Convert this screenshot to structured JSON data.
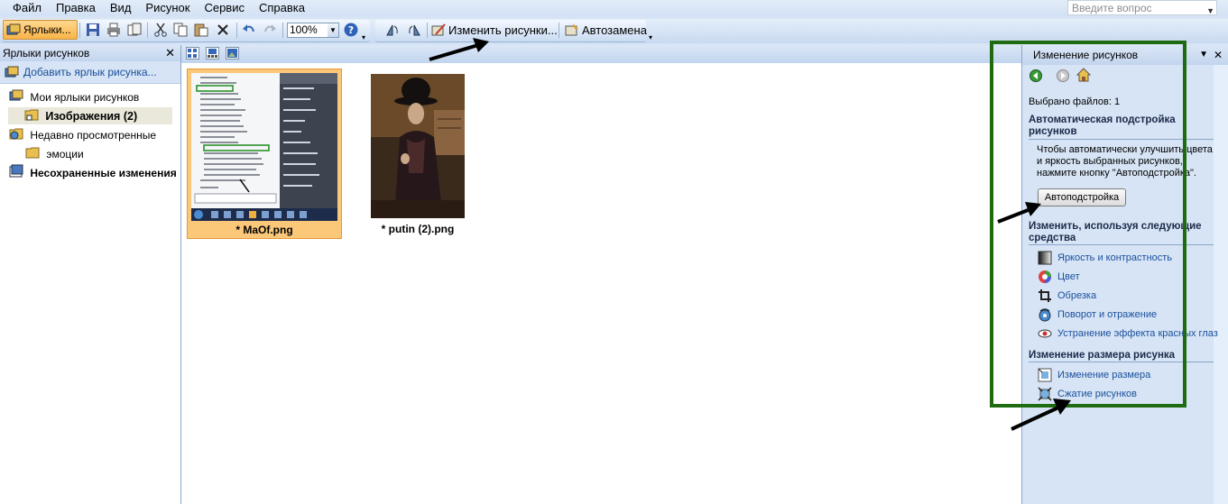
{
  "menu": {
    "items": [
      "Файл",
      "Правка",
      "Вид",
      "Рисунок",
      "Сервис",
      "Справка"
    ],
    "help_placeholder": "Введите вопрос"
  },
  "toolbar": {
    "shortcuts_label": "Ярлыки...",
    "zoom": "100%",
    "edit_pictures_label": "Изменить рисунки...",
    "autocorrect_label": "Автозамена"
  },
  "left_pane": {
    "title": "Ярлыки рисунков",
    "add_shortcut": "Добавить ярлык рисунка...",
    "tree": {
      "my_shortcuts": "Мои ярлыки рисунков",
      "images": "Изображения (2)",
      "recent": "Недавно просмотренные",
      "emoji": "эмоции",
      "unsaved": "Несохраненные изменения"
    }
  },
  "thumbnails": [
    {
      "label": "* MaOf.png",
      "selected": true
    },
    {
      "label": "* putin (2).png",
      "selected": false
    }
  ],
  "right_pane": {
    "title": "Изменение рисунков",
    "selected_files": "Выбрано файлов: 1",
    "auto_heading": "Автоматическая подстройка рисунков",
    "auto_text": "Чтобы автоматически улучшить цвета и яркость выбранных рисунков, нажмите кнопку \"Автоподстройка\".",
    "autofix_button": "Автоподстройка",
    "edit_heading": "Изменить, используя следующие средства",
    "tools": [
      {
        "label": "Яркость и контрастность",
        "icon": "brightness-icon"
      },
      {
        "label": "Цвет",
        "icon": "color-icon"
      },
      {
        "label": "Обрезка",
        "icon": "crop-icon"
      },
      {
        "label": "Поворот и отражение",
        "icon": "rotate-icon"
      },
      {
        "label": "Устранение эффекта красных глаз",
        "icon": "red-eye-icon"
      }
    ],
    "resize_heading": "Изменение размера рисунка",
    "resize_tools": [
      {
        "label": "Изменение размера",
        "icon": "resize-icon"
      },
      {
        "label": "Сжатие рисунков",
        "icon": "compress-icon"
      }
    ]
  },
  "colors": {
    "accent_green": "#1e6b10",
    "selection_orange": "#f9b348",
    "link_blue": "#1a4f9c"
  }
}
